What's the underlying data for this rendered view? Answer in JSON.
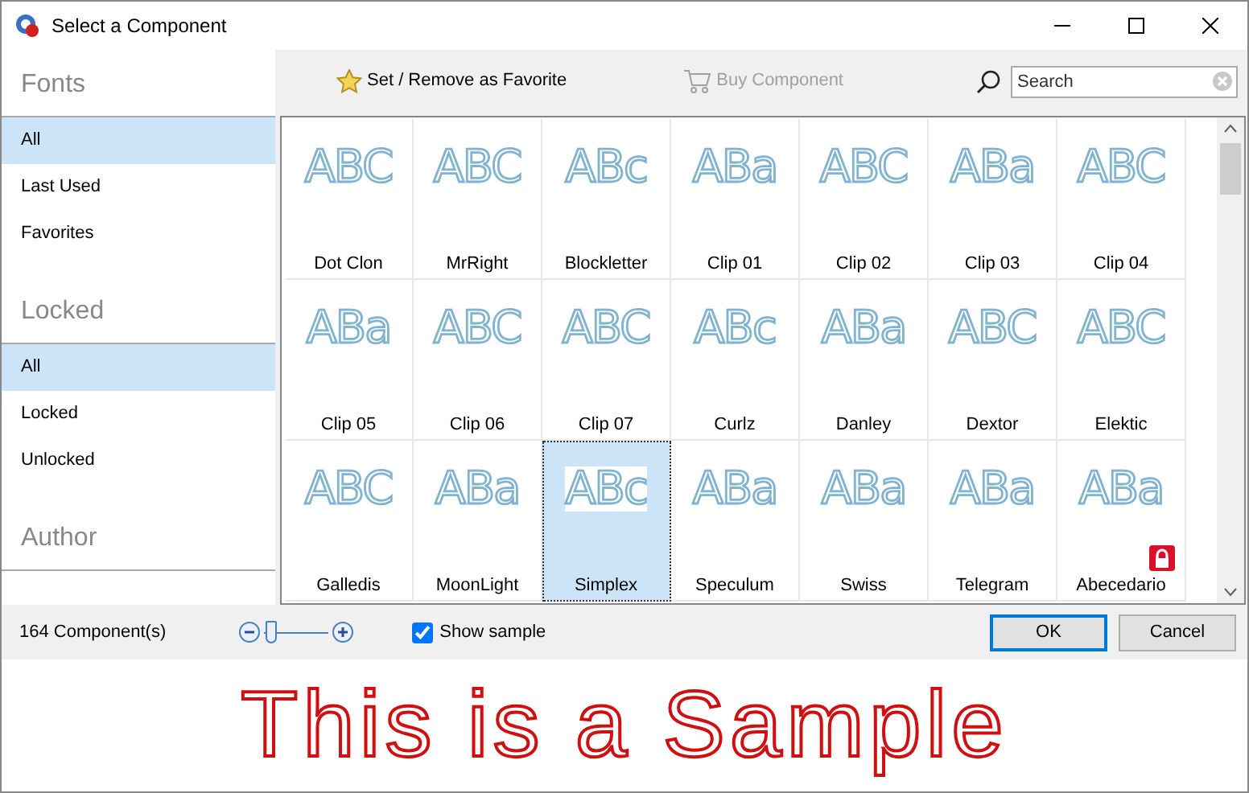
{
  "window": {
    "title": "Select a Component"
  },
  "sidebar": {
    "sections": [
      {
        "title": "Fonts",
        "items": [
          {
            "label": "All",
            "selected": true
          },
          {
            "label": "Last Used",
            "selected": false
          },
          {
            "label": "Favorites",
            "selected": false
          }
        ]
      },
      {
        "title": "Locked",
        "items": [
          {
            "label": "All",
            "selected": true
          },
          {
            "label": "Locked",
            "selected": false
          },
          {
            "label": "Unlocked",
            "selected": false
          }
        ]
      },
      {
        "title": "Author"
      }
    ]
  },
  "toolbar": {
    "favorite_button": {
      "label": "Set / Remove as Favorite",
      "disabled": false
    },
    "buy_button": {
      "label": "Buy Component",
      "disabled": true
    },
    "search": {
      "placeholder": "Search"
    }
  },
  "components": [
    {
      "name": "Dot Clon",
      "preview": "ABC",
      "selected": false,
      "locked": false
    },
    {
      "name": "MrRight",
      "preview": "ABC",
      "selected": false,
      "locked": false
    },
    {
      "name": "Blockletter",
      "preview": "ABc",
      "selected": false,
      "locked": false
    },
    {
      "name": "Clip 01",
      "preview": "ABa",
      "selected": false,
      "locked": false
    },
    {
      "name": "Clip 02",
      "preview": "ABC",
      "selected": false,
      "locked": false
    },
    {
      "name": "Clip 03",
      "preview": "ABa",
      "selected": false,
      "locked": false
    },
    {
      "name": "Clip 04",
      "preview": "ABC",
      "selected": false,
      "locked": false
    },
    {
      "name": "Clip 05",
      "preview": "ABa",
      "selected": false,
      "locked": false
    },
    {
      "name": "Clip 06",
      "preview": "ABC",
      "selected": false,
      "locked": false
    },
    {
      "name": "Clip 07",
      "preview": "ABC",
      "selected": false,
      "locked": false
    },
    {
      "name": "Curlz",
      "preview": "ABc",
      "selected": false,
      "locked": false
    },
    {
      "name": "Danley",
      "preview": "ABa",
      "selected": false,
      "locked": false
    },
    {
      "name": "Dextor",
      "preview": "ABC",
      "selected": false,
      "locked": false
    },
    {
      "name": "Elektic",
      "preview": "ABC",
      "selected": false,
      "locked": false
    },
    {
      "name": "Galledis",
      "preview": "ABC",
      "selected": false,
      "locked": false
    },
    {
      "name": "MoonLight",
      "preview": "ABa",
      "selected": false,
      "locked": false
    },
    {
      "name": "Simplex",
      "preview": "ABc",
      "selected": true,
      "locked": false
    },
    {
      "name": "Speculum",
      "preview": "ABa",
      "selected": false,
      "locked": false
    },
    {
      "name": "Swiss",
      "preview": "ABa",
      "selected": false,
      "locked": false
    },
    {
      "name": "Telegram",
      "preview": "ABa",
      "selected": false,
      "locked": false
    },
    {
      "name": "Abecedario",
      "preview": "ABa",
      "selected": false,
      "locked": true
    }
  ],
  "status_bar": {
    "count": "164 Component(s)",
    "zoom": {
      "level": 0.1
    },
    "show_sample": {
      "label": "Show sample",
      "checked": true
    },
    "buttons": [
      {
        "label": "OK",
        "kind": "default"
      },
      {
        "label": "Cancel",
        "kind": "normal"
      }
    ]
  },
  "sample": {
    "text": "This is a Sample"
  }
}
